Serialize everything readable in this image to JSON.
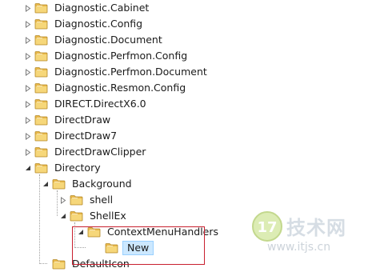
{
  "registry_tree": {
    "items": [
      {
        "label": "Diagnostic.Cabinet",
        "arrow": "collapsed",
        "depth": 0
      },
      {
        "label": "Diagnostic.Config",
        "arrow": "collapsed",
        "depth": 0
      },
      {
        "label": "Diagnostic.Document",
        "arrow": "collapsed",
        "depth": 0
      },
      {
        "label": "Diagnostic.Perfmon.Config",
        "arrow": "collapsed",
        "depth": 0
      },
      {
        "label": "Diagnostic.Perfmon.Document",
        "arrow": "collapsed",
        "depth": 0
      },
      {
        "label": "Diagnostic.Resmon.Config",
        "arrow": "collapsed",
        "depth": 0
      },
      {
        "label": "DIRECT.DirectX6.0",
        "arrow": "collapsed",
        "depth": 0
      },
      {
        "label": "DirectDraw",
        "arrow": "collapsed",
        "depth": 0
      },
      {
        "label": "DirectDraw7",
        "arrow": "collapsed",
        "depth": 0
      },
      {
        "label": "DirectDrawClipper",
        "arrow": "collapsed",
        "depth": 0
      },
      {
        "label": "Directory",
        "arrow": "expanded",
        "depth": 0
      },
      {
        "label": "Background",
        "arrow": "expanded",
        "depth": 1
      },
      {
        "label": "shell",
        "arrow": "collapsed",
        "depth": 2
      },
      {
        "label": "ShellEx",
        "arrow": "expanded",
        "depth": 2
      },
      {
        "label": "ContextMenuHandlers",
        "arrow": "expanded",
        "depth": 3
      },
      {
        "label": "New",
        "arrow": "none",
        "depth": 4,
        "selected": true
      },
      {
        "label": "DefaultIcon",
        "arrow": "none",
        "depth": 1
      }
    ]
  },
  "watermark": {
    "title": "技术网",
    "url": "www.itjs.cn"
  },
  "colors": {
    "highlight_border": "#c8202f",
    "selection_bg": "#cce8ff",
    "folder_yellow": "#e8b84a"
  }
}
